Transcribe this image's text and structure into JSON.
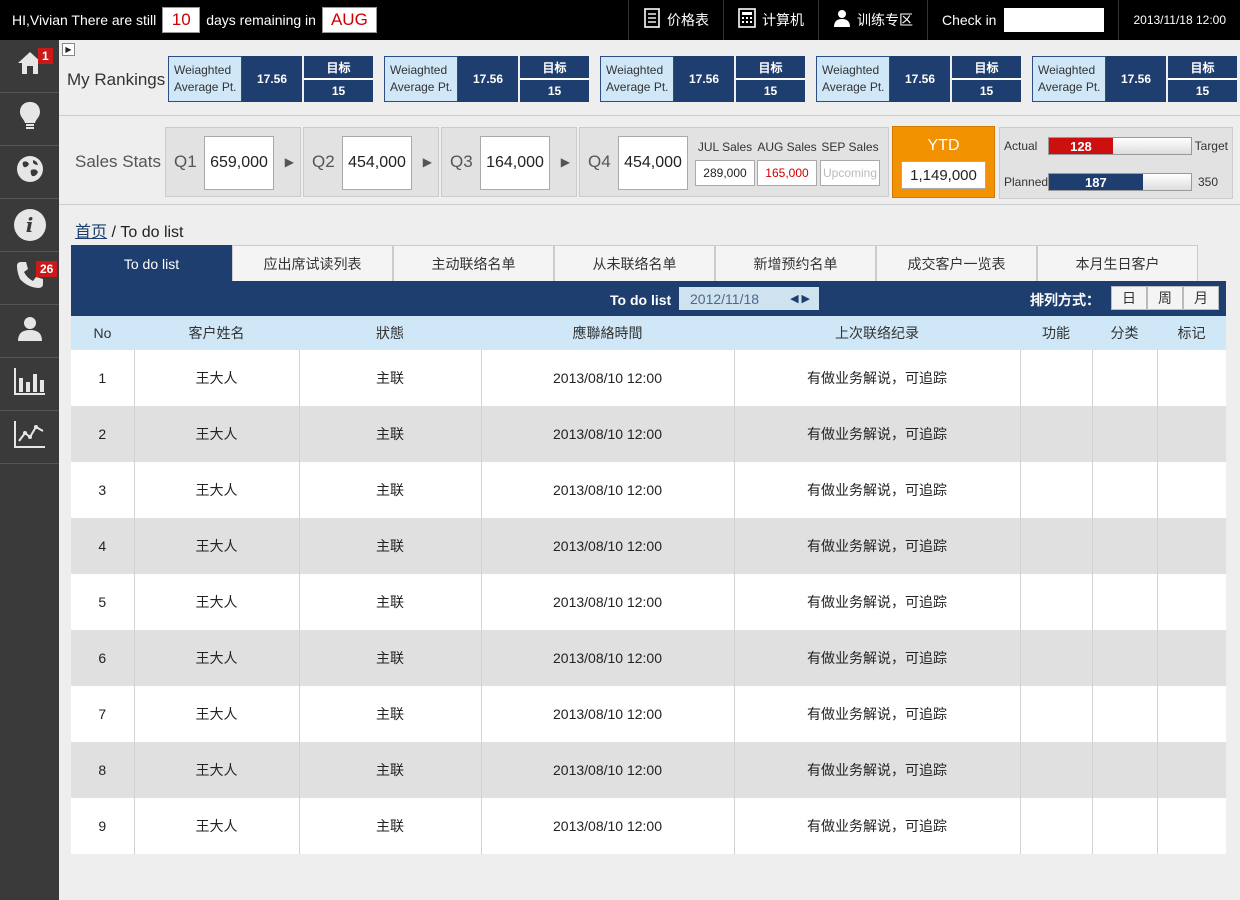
{
  "topbar": {
    "greeting": "HI,Vivian There are still",
    "days": "10",
    "remaining_text": "days remaining in",
    "month": "AUG",
    "price_list": "价格表",
    "calculator": "计算机",
    "training": "训练专区",
    "checkin_label": "Check in",
    "datetime": "2013/11/18 12:00"
  },
  "sidebar": {
    "home_badge": "1",
    "phone_badge": "26"
  },
  "rankings": {
    "title": "My Rankings",
    "cards": [
      {
        "label_line1": "Weiaghted",
        "label_line2": "Average Pt.",
        "value": "17.56",
        "target_label": "目标",
        "target_value": "15"
      },
      {
        "label_line1": "Weiaghted",
        "label_line2": "Average Pt.",
        "value": "17.56",
        "target_label": "目标",
        "target_value": "15"
      },
      {
        "label_line1": "Weiaghted",
        "label_line2": "Average Pt.",
        "value": "17.56",
        "target_label": "目标",
        "target_value": "15"
      },
      {
        "label_line1": "Weiaghted",
        "label_line2": "Average Pt.",
        "value": "17.56",
        "target_label": "目标",
        "target_value": "15"
      },
      {
        "label_line1": "Weiaghted",
        "label_line2": "Average Pt.",
        "value": "17.56",
        "target_label": "目标",
        "target_value": "15"
      }
    ]
  },
  "sales": {
    "title": "Sales Stats",
    "quarters": [
      {
        "label": "Q1",
        "value": "659,000"
      },
      {
        "label": "Q2",
        "value": "454,000"
      },
      {
        "label": "Q3",
        "value": "164,000"
      },
      {
        "label": "Q4",
        "value": "454,000"
      }
    ],
    "months": [
      {
        "label": "JUL Sales",
        "value": "289,000"
      },
      {
        "label": "AUG Sales",
        "value": "165,000"
      },
      {
        "label": "SEP Sales",
        "value": "Upcoming"
      }
    ],
    "ytd_label": "YTD",
    "ytd_value": "1,149,000",
    "actual_label": "Actual",
    "actual_value": "128",
    "actual_fraction": 0.45,
    "target_label": "Target",
    "planned_label": "Planned",
    "planned_value": "187",
    "planned_fraction": 0.66,
    "planned_target": "350",
    "colors": {
      "actual": "#cc1010",
      "planned": "#1d3e6e",
      "ytd": "#f39200"
    }
  },
  "breadcrumb": {
    "home": "首页",
    "separator": " / ",
    "current": "To do list"
  },
  "tabs": [
    "To do list",
    "应出席试读列表",
    "主动联络名单",
    "从未联络名单",
    "新增预约名单",
    "成交客户一览表",
    "本月生日客户"
  ],
  "listbar": {
    "title": "To do list",
    "date": "2012/11/18",
    "sort_label": "排列方式：",
    "sort_options": [
      "日",
      "周",
      "月"
    ]
  },
  "table": {
    "headers": [
      "No",
      "客户姓名",
      "狀態",
      "應聯絡時間",
      "上次联络纪录",
      "功能",
      "分类",
      "标记"
    ],
    "rows": [
      [
        "1",
        "王大人",
        "主联",
        "2013/08/10 12:00",
        "有做业务解说，可追踪",
        "",
        "",
        ""
      ],
      [
        "2",
        "王大人",
        "主联",
        "2013/08/10 12:00",
        "有做业务解说，可追踪",
        "",
        "",
        ""
      ],
      [
        "3",
        "王大人",
        "主联",
        "2013/08/10 12:00",
        "有做业务解说，可追踪",
        "",
        "",
        ""
      ],
      [
        "4",
        "王大人",
        "主联",
        "2013/08/10 12:00",
        "有做业务解说，可追踪",
        "",
        "",
        ""
      ],
      [
        "5",
        "王大人",
        "主联",
        "2013/08/10 12:00",
        "有做业务解说，可追踪",
        "",
        "",
        ""
      ],
      [
        "6",
        "王大人",
        "主联",
        "2013/08/10 12:00",
        "有做业务解说，可追踪",
        "",
        "",
        ""
      ],
      [
        "7",
        "王大人",
        "主联",
        "2013/08/10 12:00",
        "有做业务解说，可追踪",
        "",
        "",
        ""
      ],
      [
        "8",
        "王大人",
        "主联",
        "2013/08/10 12:00",
        "有做业务解说，可追踪",
        "",
        "",
        ""
      ],
      [
        "9",
        "王大人",
        "主联",
        "2013/08/10 12:00",
        "有做业务解说，可追踪",
        "",
        "",
        ""
      ]
    ]
  }
}
